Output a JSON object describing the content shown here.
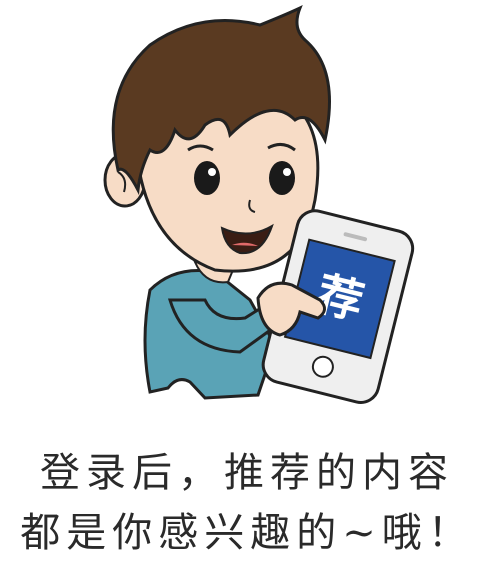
{
  "illustration": {
    "screen_text": "荐",
    "colors": {
      "skin": "#f7dcc6",
      "hair": "#5a3a21",
      "shirt": "#5aa3b6",
      "phone": "#e6e6e6",
      "screen": "#2555a8",
      "outline": "#222222"
    }
  },
  "caption": {
    "line1": "登录后，推荐的内容",
    "line2": "都是你感兴趣的~哦！"
  }
}
